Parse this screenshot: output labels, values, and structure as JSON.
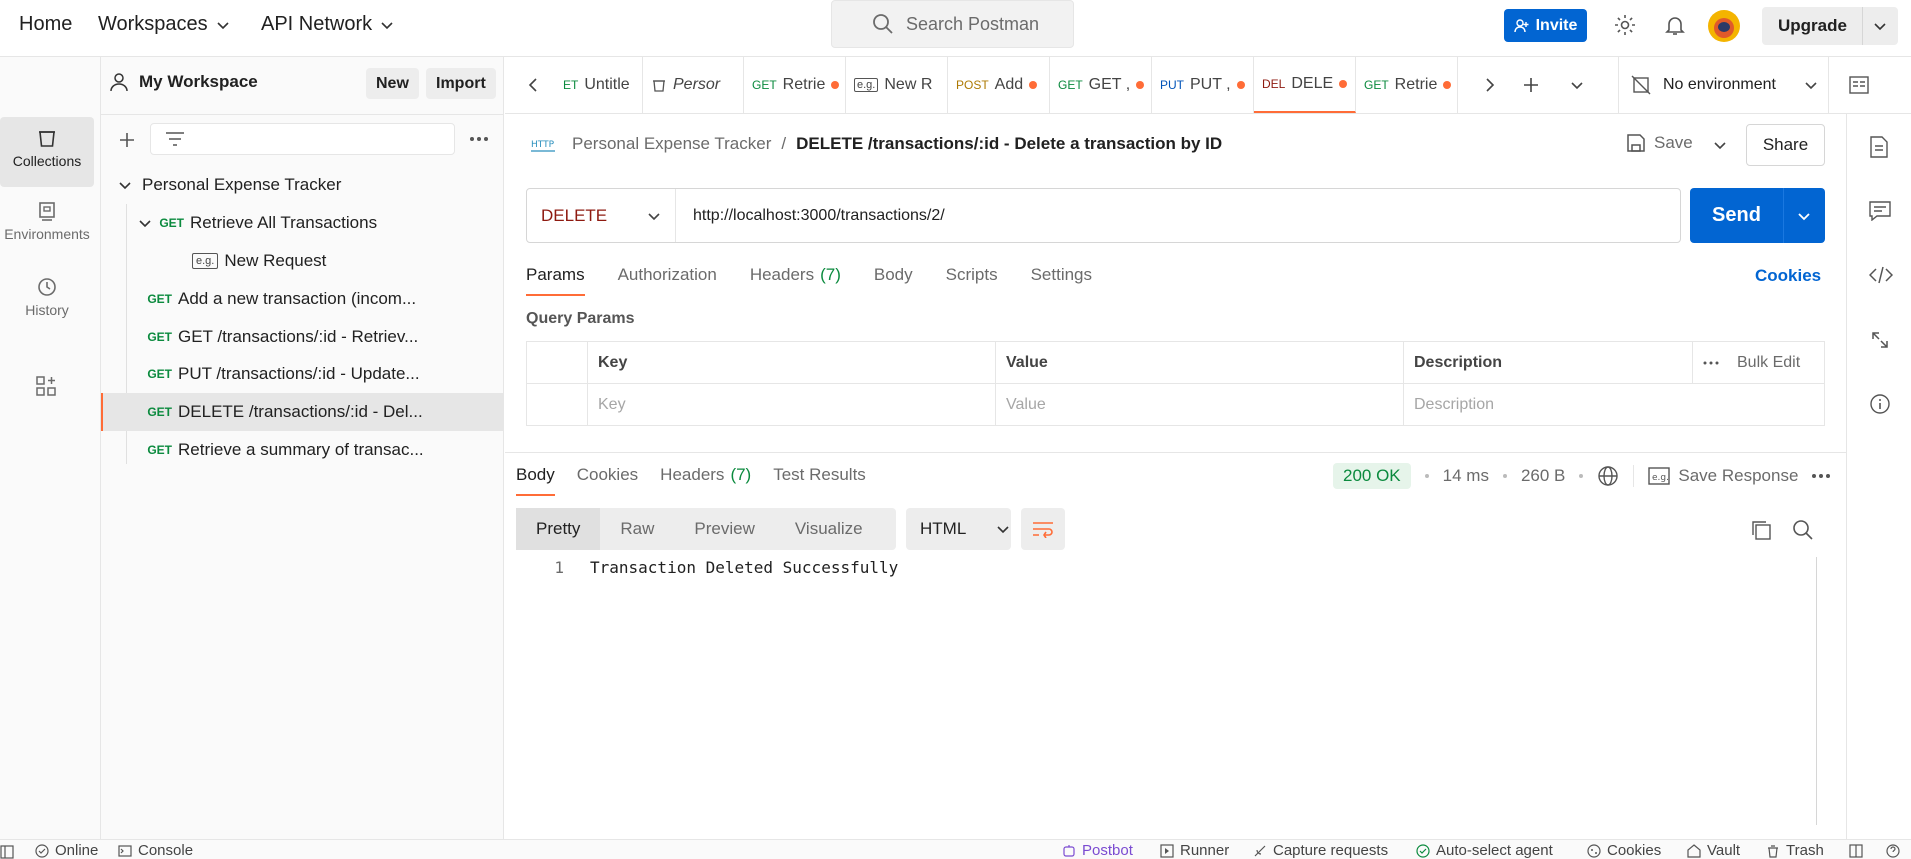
{
  "topbar": {
    "home": "Home",
    "workspaces": "Workspaces",
    "api_network": "API Network",
    "search_placeholder": "Search Postman",
    "invite": "Invite",
    "upgrade": "Upgrade"
  },
  "rail": {
    "collections": "Collections",
    "environments": "Environments",
    "history": "History"
  },
  "sidebar": {
    "workspace_name": "My Workspace",
    "new_btn": "New",
    "import_btn": "Import",
    "collection": "Personal Expense Tracker",
    "items": [
      {
        "method": "GET",
        "label": "Retrieve All Transactions"
      },
      {
        "method": "e.g.",
        "label": "New Request"
      },
      {
        "method": "GET",
        "label": "Add a new transaction (incom..."
      },
      {
        "method": "GET",
        "label": "GET /transactions/:id - Retriev..."
      },
      {
        "method": "GET",
        "label": "PUT /transactions/:id - Update..."
      },
      {
        "method": "GET",
        "label": "DELETE /transactions/:id - Del..."
      },
      {
        "method": "GET",
        "label": "Retrieve a summary of transac..."
      }
    ]
  },
  "tabs": [
    {
      "method": "ET",
      "label": "Untitle",
      "dot": false
    },
    {
      "method": "",
      "label": "Persor",
      "dot": false
    },
    {
      "method": "GET",
      "label": "Retrie",
      "dot": true
    },
    {
      "method": "e.g.",
      "label": "New R",
      "dot": false
    },
    {
      "method": "POST",
      "label": "Add",
      "dot": true
    },
    {
      "method": "GET",
      "label": "GET ,",
      "dot": true
    },
    {
      "method": "PUT",
      "label": "PUT ,",
      "dot": true
    },
    {
      "method": "DEL",
      "label": "DELE",
      "dot": true
    },
    {
      "method": "GET",
      "label": "Retrie",
      "dot": true
    }
  ],
  "environment": "No environment",
  "request": {
    "crumb_parent": "Personal Expense Tracker",
    "crumb_sep": "/",
    "crumb_title": "DELETE /transactions/:id - Delete a transaction by ID",
    "save": "Save",
    "share": "Share",
    "method": "DELETE",
    "url": "http://localhost:3000/transactions/2/",
    "send": "Send",
    "tabs": {
      "params": "Params",
      "authorization": "Authorization",
      "headers": "Headers",
      "headers_count": "(7)",
      "body": "Body",
      "scripts": "Scripts",
      "settings": "Settings",
      "cookies": "Cookies"
    },
    "query_params_title": "Query Params",
    "qp_headers": {
      "key": "Key",
      "value": "Value",
      "description": "Description",
      "bulk_edit": "Bulk Edit"
    },
    "qp_placeholders": {
      "key": "Key",
      "value": "Value",
      "description": "Description"
    }
  },
  "response": {
    "tabs": {
      "body": "Body",
      "cookies": "Cookies",
      "headers": "Headers",
      "headers_count": "(7)",
      "tests": "Test Results"
    },
    "status": "200 OK",
    "time": "14 ms",
    "size": "260 B",
    "save_response": "Save Response",
    "view_modes": [
      "Pretty",
      "Raw",
      "Preview",
      "Visualize"
    ],
    "format": "HTML",
    "line_no": "1",
    "body_text": "Transaction Deleted Successfully"
  },
  "statusbar": {
    "online": "Online",
    "console": "Console",
    "postbot": "Postbot",
    "runner": "Runner",
    "capture": "Capture requests",
    "auto_select": "Auto-select agent",
    "cookies": "Cookies",
    "vault": "Vault",
    "trash": "Trash"
  },
  "colors": {
    "accent": "#ff6c37",
    "primary": "#0265d2",
    "get": "#0b8a3e",
    "delete": "#8e1a10",
    "status_ok": "#0b8a3e"
  }
}
